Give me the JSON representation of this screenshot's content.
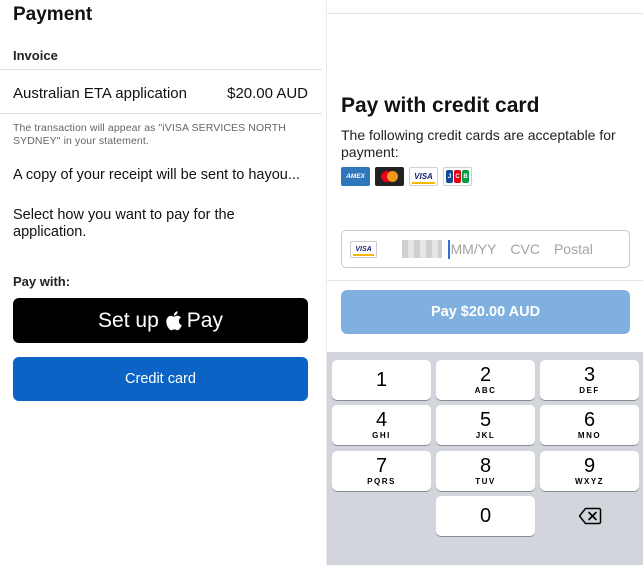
{
  "left": {
    "title": "Payment",
    "invoice_label": "Invoice",
    "item_name": "Australian ETA application",
    "item_price": "$20.00 AUD",
    "disclaimer": "The transaction will appear as \"iVISA SERVICES NORTH SYDNEY\" in your statement.",
    "receipt_text": "A copy of your receipt will be sent to hayou...",
    "select_text": "Select how you want to pay for the application.",
    "pay_with_label": "Pay with:",
    "apple_pay_prefix": "Set up",
    "apple_pay_suffix": "Pay",
    "credit_card_button": "Credit card"
  },
  "right": {
    "title": "Pay with credit card",
    "subtitle": "The following credit cards are acceptable for payment:",
    "card_logos": [
      {
        "name": "amex",
        "text": "AMEX"
      },
      {
        "name": "mastercard",
        "text": ""
      },
      {
        "name": "visa",
        "text": "VISA"
      },
      {
        "name": "jcb",
        "text": "JCB"
      }
    ],
    "input": {
      "card_brand": "VISA",
      "expiry_placeholder": "MM/YY",
      "cvc_placeholder": "CVC",
      "postal_placeholder": "Postal"
    },
    "pay_button": "Pay $20.00 AUD",
    "keypad": {
      "keys": [
        {
          "num": "1",
          "letters": ""
        },
        {
          "num": "2",
          "letters": "ABC"
        },
        {
          "num": "3",
          "letters": "DEF"
        },
        {
          "num": "4",
          "letters": "GHI"
        },
        {
          "num": "5",
          "letters": "JKL"
        },
        {
          "num": "6",
          "letters": "MNO"
        },
        {
          "num": "7",
          "letters": "PQRS"
        },
        {
          "num": "8",
          "letters": "TUV"
        },
        {
          "num": "9",
          "letters": "WXYZ"
        },
        {
          "num": "0",
          "letters": ""
        }
      ],
      "delete_icon": "backspace-icon"
    }
  },
  "colors": {
    "primary_blue": "#0b63c6",
    "disabled_blue": "#7fb0df",
    "apple_black": "#000000",
    "keypad_bg": "#d2d5db"
  }
}
